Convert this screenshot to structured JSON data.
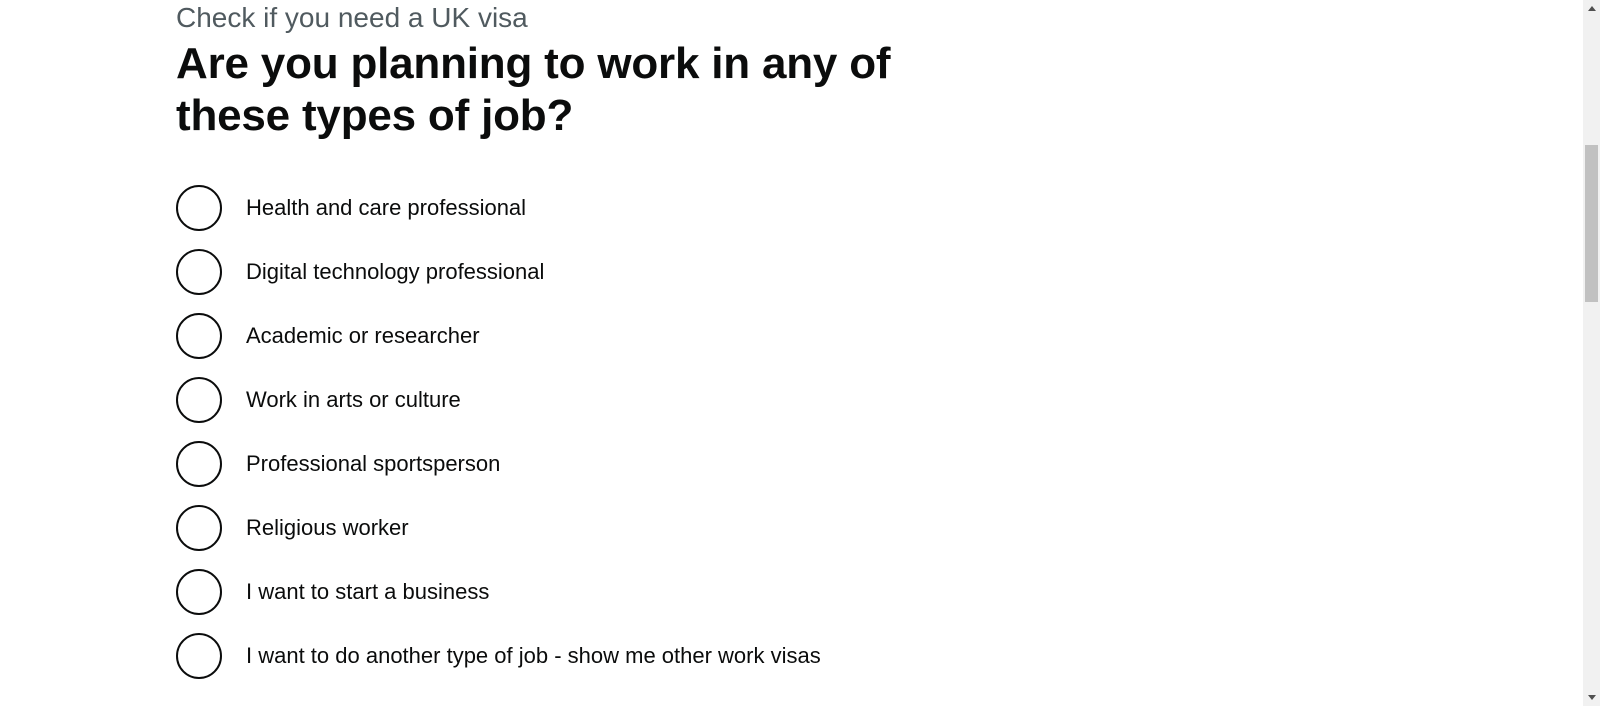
{
  "page": {
    "caption": "Check if you need a UK visa",
    "question": "Are you planning to work in any of these types of job?"
  },
  "options": [
    {
      "label": "Health and care professional",
      "selected": false
    },
    {
      "label": "Digital technology professional",
      "selected": false
    },
    {
      "label": "Academic or researcher",
      "selected": false
    },
    {
      "label": "Work in arts or culture",
      "selected": false
    },
    {
      "label": "Professional sportsperson",
      "selected": false
    },
    {
      "label": "Religious worker",
      "selected": false
    },
    {
      "label": "I want to start a business",
      "selected": false
    },
    {
      "label": "I want to do another type of job - show me other work visas",
      "selected": false
    }
  ],
  "colors": {
    "text": "#0b0c0c",
    "caption": "#505a5f",
    "scrollbar_track": "#f1f1f1",
    "scrollbar_thumb": "#c1c1c1"
  }
}
